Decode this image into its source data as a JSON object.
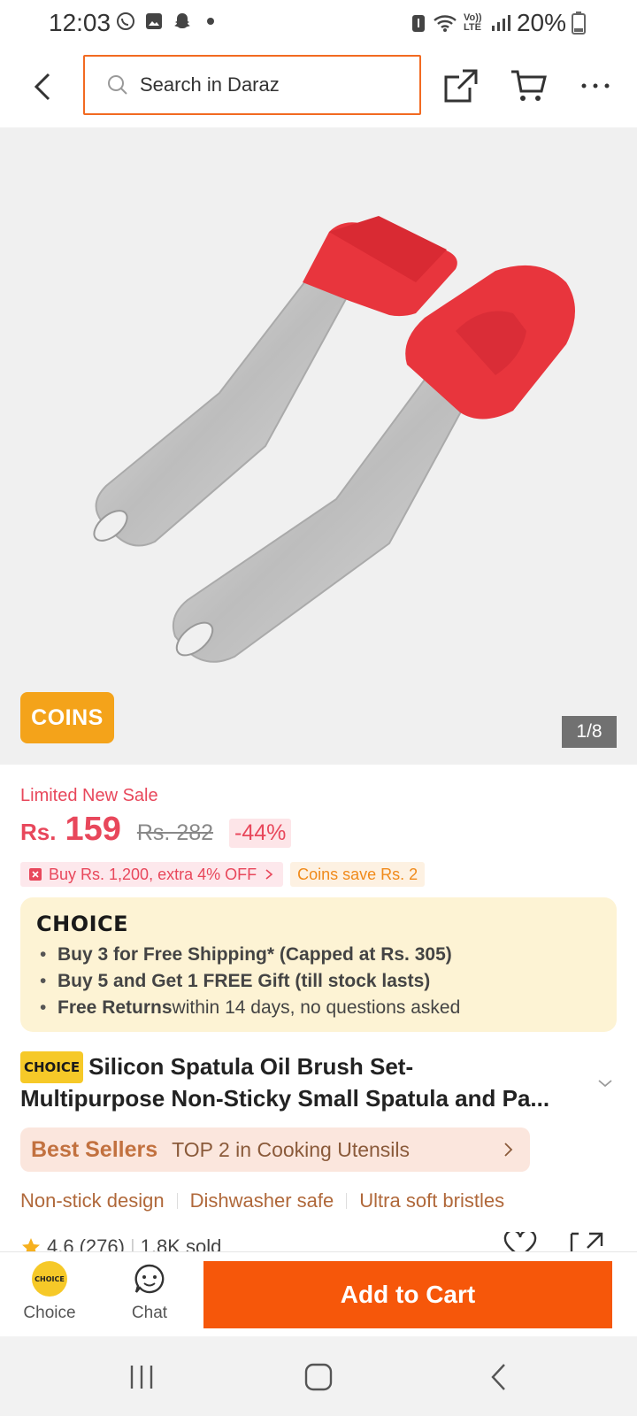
{
  "status_bar": {
    "time": "12:03",
    "battery": "20%",
    "icons": [
      "whatsapp-icon",
      "gallery-icon",
      "snapchat-icon",
      "dot-icon"
    ],
    "right_icons": [
      "battery-saver-icon",
      "wifi-icon",
      "volte-icon",
      "signal-icon",
      "battery-icon"
    ],
    "volte_label": "Vo)) LTE"
  },
  "header": {
    "search_placeholder": "Search in Daraz",
    "icons": [
      "back-icon",
      "search-icon",
      "share-icon",
      "cart-icon",
      "more-icon"
    ]
  },
  "gallery": {
    "badge": "COINS",
    "counter": "1/8",
    "accent": "#e8353d"
  },
  "price": {
    "sale_label": "Limited New Sale",
    "currency": "Rs.",
    "current": "159",
    "original": "Rs. 282",
    "discount": "-44%"
  },
  "promos": {
    "offer": "Buy Rs. 1,200, extra 4% OFF",
    "coins": "Coins save Rs. 2"
  },
  "choice": {
    "logo": "CHOICE",
    "items": [
      {
        "bold": "Buy 3 for  Free Shipping* (Capped at Rs. 305)",
        "rest": ""
      },
      {
        "bold": "Buy 5 and Get 1 FREE Gift (till stock lasts)",
        "rest": ""
      },
      {
        "bold": "Free Returns",
        "rest": " within 14 days, no questions asked"
      }
    ]
  },
  "product": {
    "badge": "CHOICE",
    "title_line1": "Silicon Spatula Oil Brush Set-",
    "title_line2": "Multipurpose Non-Sticky Small Spatula and Pa..."
  },
  "bestseller": {
    "logo": "Best Sellers",
    "text": "TOP 2 in Cooking Utensils"
  },
  "features": [
    "Non-stick design",
    "Dishwasher safe",
    "Ultra soft bristles"
  ],
  "rating": {
    "score": "4.6",
    "count": "(276)",
    "sold": "1.8K sold"
  },
  "action_bar": {
    "choice_label": "Choice",
    "choice_logo": "CHOICE",
    "chat_label": "Chat",
    "add_to_cart": "Add to Cart"
  },
  "colors": {
    "brand": "#f6570a",
    "price": "#e8475b",
    "search_border": "#f26a21"
  }
}
